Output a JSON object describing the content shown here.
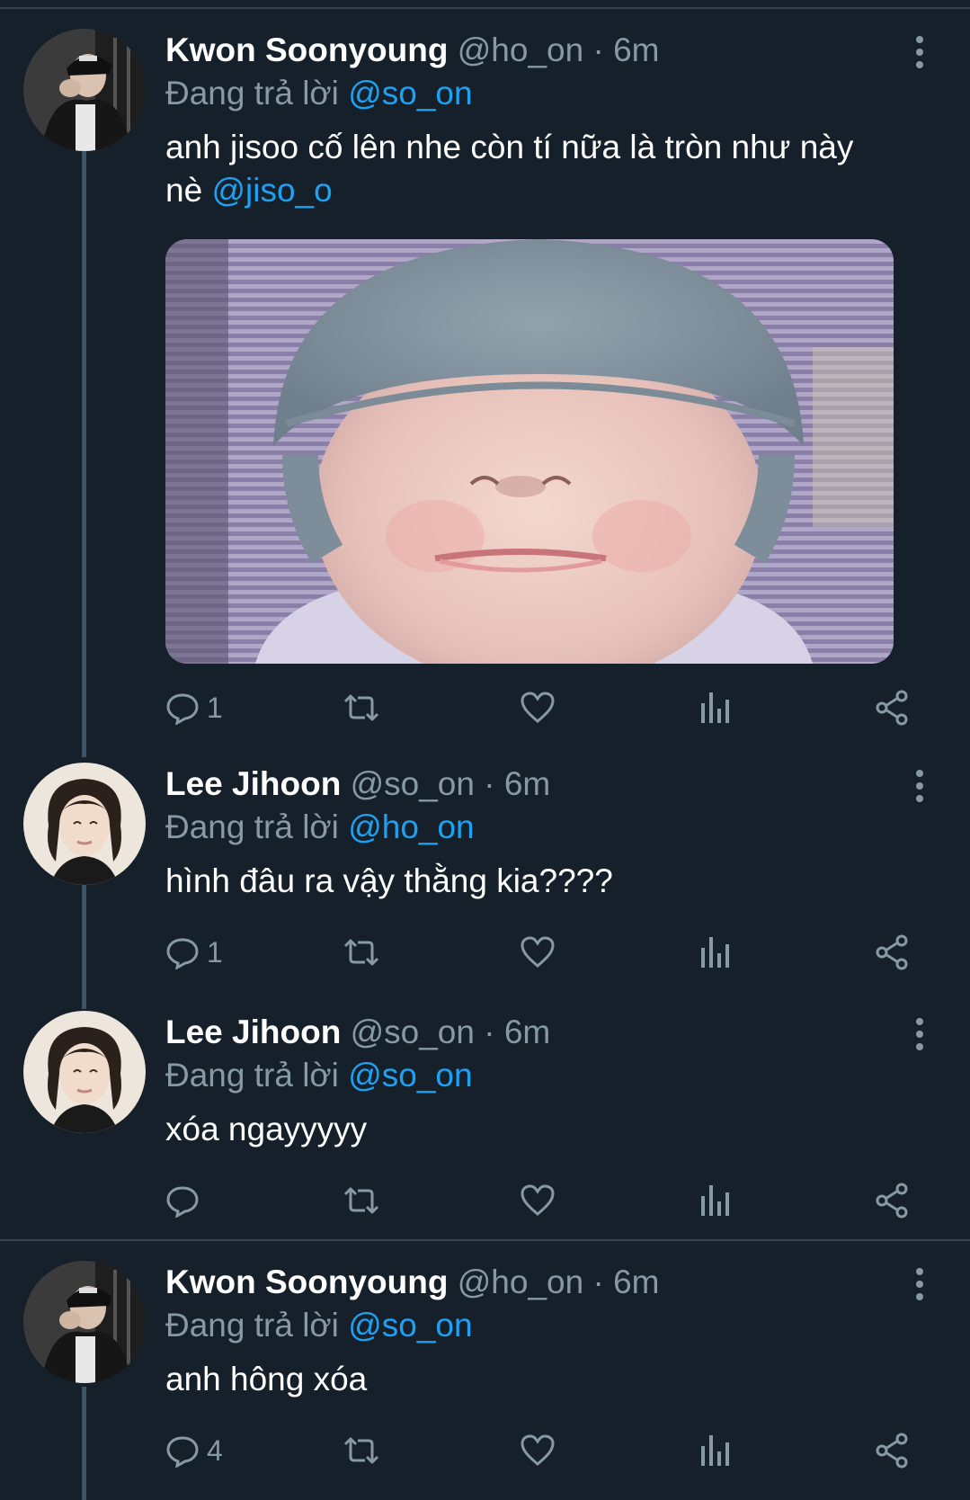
{
  "tweets": [
    {
      "name": "Kwon Soonyoung",
      "handle": "@ho_on",
      "time": "6m",
      "reply_prefix": "Đang trả lời",
      "reply_to": "@so_on",
      "text": "anh jisoo cố lên nhe còn tí nữa là tròn như này",
      "text_line2_prefix": "nè",
      "text_mention": "@jiso_o",
      "reply_count": "1"
    },
    {
      "name": "Lee Jihoon",
      "handle": "@so_on",
      "time": "6m",
      "reply_prefix": "Đang trả lời",
      "reply_to": "@ho_on",
      "text": "hình đâu ra vậy thằng kia????",
      "reply_count": "1"
    },
    {
      "name": "Lee Jihoon",
      "handle": "@so_on",
      "time": "6m",
      "reply_prefix": "Đang trả lời",
      "reply_to": "@so_on",
      "text": "xóa ngayyyyy",
      "reply_count": ""
    },
    {
      "name": "Kwon Soonyoung",
      "handle": "@ho_on",
      "time": "6m",
      "reply_prefix": "Đang trả lời",
      "reply_to": "@so_on",
      "text": "anh hông xóa",
      "reply_count": "4"
    }
  ],
  "separator": " · ",
  "icons": {
    "reply": "reply-bubble-icon",
    "retweet": "retweet-icon",
    "like": "heart-icon",
    "analytics": "analytics-icon",
    "share": "share-icon",
    "more": "more-vertical-icon"
  },
  "colors": {
    "background": "#15202b",
    "text": "#ffffff",
    "secondary": "#8899a6",
    "mention": "#1da1f2",
    "divider": "#38444d",
    "thread_line": "#3d5466"
  }
}
